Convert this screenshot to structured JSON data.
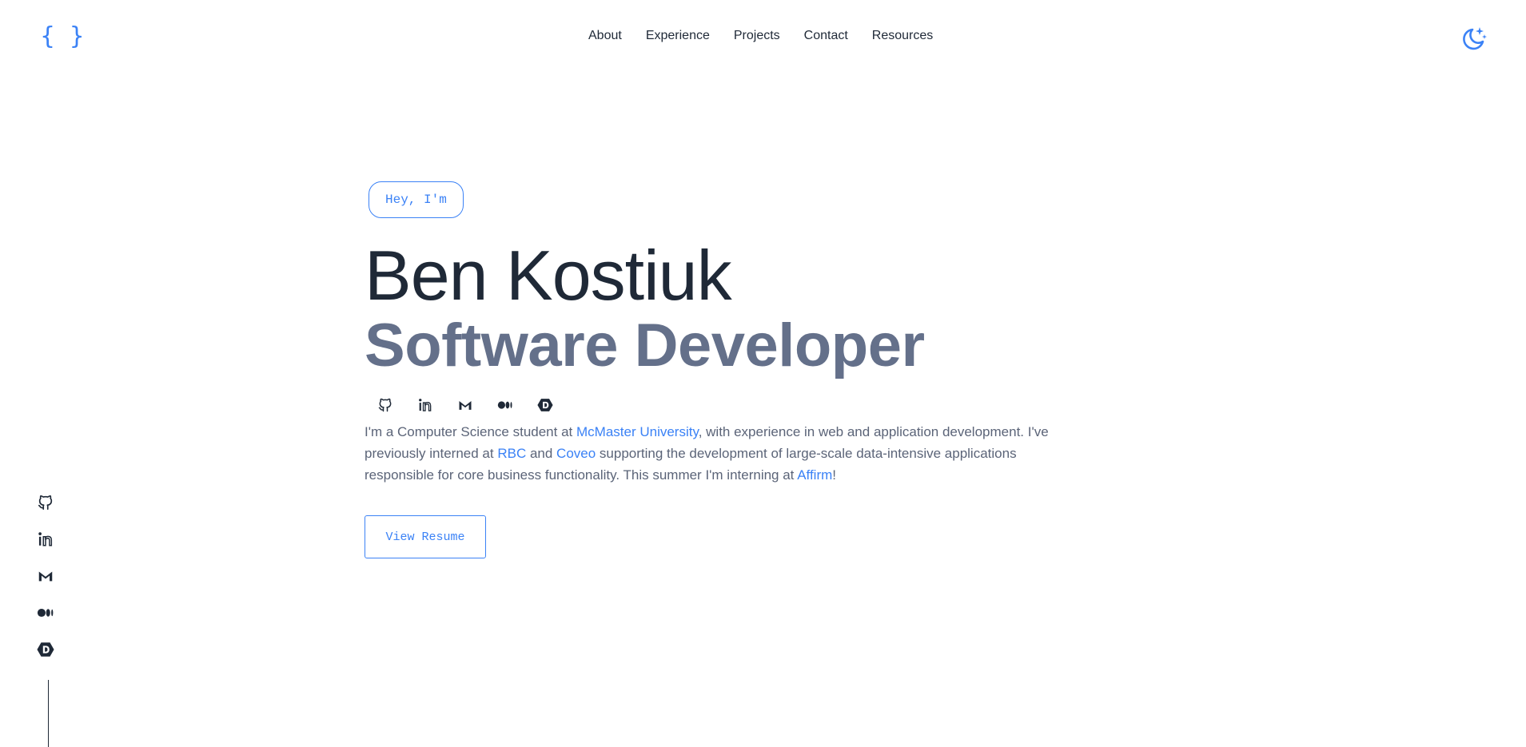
{
  "logo": {
    "text": "{ }"
  },
  "nav": {
    "items": [
      "About",
      "Experience",
      "Projects",
      "Contact",
      "Resources"
    ]
  },
  "theme_toggle": {
    "icon": "moon-stars-icon"
  },
  "social": {
    "icons": [
      "github-icon",
      "linkedin-icon",
      "gmail-icon",
      "medium-icon",
      "devpost-icon"
    ]
  },
  "hero": {
    "greeting": "Hey, I'm",
    "name": "Ben Kostiuk",
    "role": "Software Developer",
    "intro": {
      "p1": "I'm a Computer Science student at ",
      "link1": "McMaster University",
      "p2": ", with experience in web and application development. I've previously interned at ",
      "link2": "RBC",
      "p3": " and ",
      "link3": "Coveo",
      "p4": " supporting the development of large-scale data-intensive applications responsible for core business functionality. This summer I'm interning at ",
      "link4": "Affirm",
      "p5": "!"
    },
    "resume_button": "View Resume"
  },
  "colors": {
    "accent": "#3b82f6",
    "text": "#1f2937",
    "muted": "#64708a"
  }
}
